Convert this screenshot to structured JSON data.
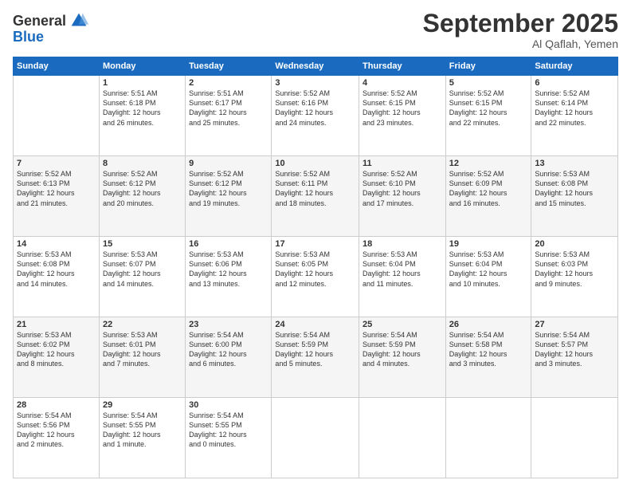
{
  "header": {
    "logo_line1": "General",
    "logo_line2": "Blue",
    "month": "September 2025",
    "location": "Al Qaflah, Yemen"
  },
  "days_of_week": [
    "Sunday",
    "Monday",
    "Tuesday",
    "Wednesday",
    "Thursday",
    "Friday",
    "Saturday"
  ],
  "weeks": [
    [
      {
        "day": "",
        "info": ""
      },
      {
        "day": "1",
        "info": "Sunrise: 5:51 AM\nSunset: 6:18 PM\nDaylight: 12 hours\nand 26 minutes."
      },
      {
        "day": "2",
        "info": "Sunrise: 5:51 AM\nSunset: 6:17 PM\nDaylight: 12 hours\nand 25 minutes."
      },
      {
        "day": "3",
        "info": "Sunrise: 5:52 AM\nSunset: 6:16 PM\nDaylight: 12 hours\nand 24 minutes."
      },
      {
        "day": "4",
        "info": "Sunrise: 5:52 AM\nSunset: 6:15 PM\nDaylight: 12 hours\nand 23 minutes."
      },
      {
        "day": "5",
        "info": "Sunrise: 5:52 AM\nSunset: 6:15 PM\nDaylight: 12 hours\nand 22 minutes."
      },
      {
        "day": "6",
        "info": "Sunrise: 5:52 AM\nSunset: 6:14 PM\nDaylight: 12 hours\nand 22 minutes."
      }
    ],
    [
      {
        "day": "7",
        "info": "Sunrise: 5:52 AM\nSunset: 6:13 PM\nDaylight: 12 hours\nand 21 minutes."
      },
      {
        "day": "8",
        "info": "Sunrise: 5:52 AM\nSunset: 6:12 PM\nDaylight: 12 hours\nand 20 minutes."
      },
      {
        "day": "9",
        "info": "Sunrise: 5:52 AM\nSunset: 6:12 PM\nDaylight: 12 hours\nand 19 minutes."
      },
      {
        "day": "10",
        "info": "Sunrise: 5:52 AM\nSunset: 6:11 PM\nDaylight: 12 hours\nand 18 minutes."
      },
      {
        "day": "11",
        "info": "Sunrise: 5:52 AM\nSunset: 6:10 PM\nDaylight: 12 hours\nand 17 minutes."
      },
      {
        "day": "12",
        "info": "Sunrise: 5:52 AM\nSunset: 6:09 PM\nDaylight: 12 hours\nand 16 minutes."
      },
      {
        "day": "13",
        "info": "Sunrise: 5:53 AM\nSunset: 6:08 PM\nDaylight: 12 hours\nand 15 minutes."
      }
    ],
    [
      {
        "day": "14",
        "info": "Sunrise: 5:53 AM\nSunset: 6:08 PM\nDaylight: 12 hours\nand 14 minutes."
      },
      {
        "day": "15",
        "info": "Sunrise: 5:53 AM\nSunset: 6:07 PM\nDaylight: 12 hours\nand 14 minutes."
      },
      {
        "day": "16",
        "info": "Sunrise: 5:53 AM\nSunset: 6:06 PM\nDaylight: 12 hours\nand 13 minutes."
      },
      {
        "day": "17",
        "info": "Sunrise: 5:53 AM\nSunset: 6:05 PM\nDaylight: 12 hours\nand 12 minutes."
      },
      {
        "day": "18",
        "info": "Sunrise: 5:53 AM\nSunset: 6:04 PM\nDaylight: 12 hours\nand 11 minutes."
      },
      {
        "day": "19",
        "info": "Sunrise: 5:53 AM\nSunset: 6:04 PM\nDaylight: 12 hours\nand 10 minutes."
      },
      {
        "day": "20",
        "info": "Sunrise: 5:53 AM\nSunset: 6:03 PM\nDaylight: 12 hours\nand 9 minutes."
      }
    ],
    [
      {
        "day": "21",
        "info": "Sunrise: 5:53 AM\nSunset: 6:02 PM\nDaylight: 12 hours\nand 8 minutes."
      },
      {
        "day": "22",
        "info": "Sunrise: 5:53 AM\nSunset: 6:01 PM\nDaylight: 12 hours\nand 7 minutes."
      },
      {
        "day": "23",
        "info": "Sunrise: 5:54 AM\nSunset: 6:00 PM\nDaylight: 12 hours\nand 6 minutes."
      },
      {
        "day": "24",
        "info": "Sunrise: 5:54 AM\nSunset: 5:59 PM\nDaylight: 12 hours\nand 5 minutes."
      },
      {
        "day": "25",
        "info": "Sunrise: 5:54 AM\nSunset: 5:59 PM\nDaylight: 12 hours\nand 4 minutes."
      },
      {
        "day": "26",
        "info": "Sunrise: 5:54 AM\nSunset: 5:58 PM\nDaylight: 12 hours\nand 3 minutes."
      },
      {
        "day": "27",
        "info": "Sunrise: 5:54 AM\nSunset: 5:57 PM\nDaylight: 12 hours\nand 3 minutes."
      }
    ],
    [
      {
        "day": "28",
        "info": "Sunrise: 5:54 AM\nSunset: 5:56 PM\nDaylight: 12 hours\nand 2 minutes."
      },
      {
        "day": "29",
        "info": "Sunrise: 5:54 AM\nSunset: 5:55 PM\nDaylight: 12 hours\nand 1 minute."
      },
      {
        "day": "30",
        "info": "Sunrise: 5:54 AM\nSunset: 5:55 PM\nDaylight: 12 hours\nand 0 minutes."
      },
      {
        "day": "",
        "info": ""
      },
      {
        "day": "",
        "info": ""
      },
      {
        "day": "",
        "info": ""
      },
      {
        "day": "",
        "info": ""
      }
    ]
  ]
}
